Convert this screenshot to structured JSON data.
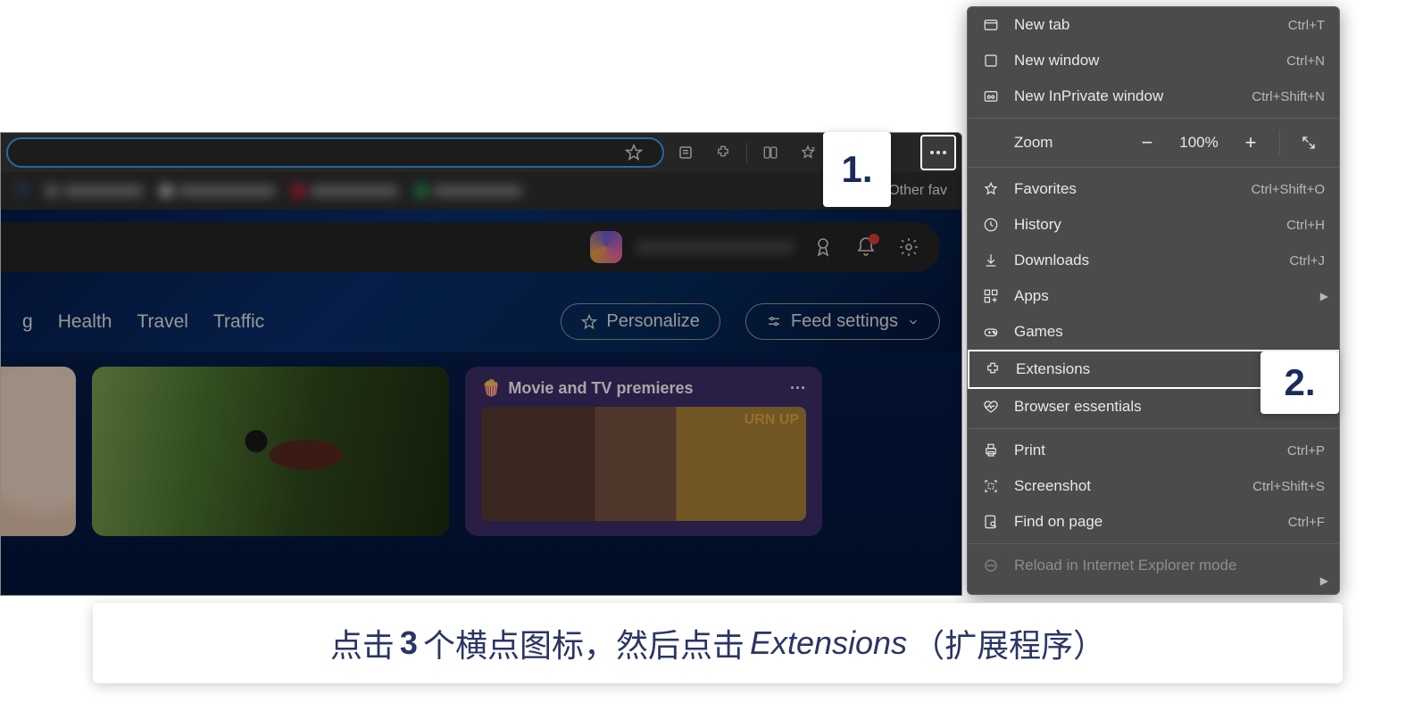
{
  "toolbar": {
    "other_favorites": "Other fav"
  },
  "nav_tabs": [
    "g",
    "Health",
    "Travel",
    "Traffic"
  ],
  "pills": {
    "personalize": "Personalize",
    "feed_settings": "Feed settings"
  },
  "card_movie": {
    "title": "Movie and TV premieres",
    "more": "···"
  },
  "zoom": {
    "label": "Zoom",
    "value": "100%"
  },
  "menu": {
    "new_tab": {
      "label": "New tab",
      "shortcut": "Ctrl+T"
    },
    "new_window": {
      "label": "New window",
      "shortcut": "Ctrl+N"
    },
    "new_inprivate": {
      "label": "New InPrivate window",
      "shortcut": "Ctrl+Shift+N"
    },
    "favorites": {
      "label": "Favorites",
      "shortcut": "Ctrl+Shift+O"
    },
    "history": {
      "label": "History",
      "shortcut": "Ctrl+H"
    },
    "downloads": {
      "label": "Downloads",
      "shortcut": "Ctrl+J"
    },
    "apps": {
      "label": "Apps"
    },
    "games": {
      "label": "Games"
    },
    "extensions": {
      "label": "Extensions"
    },
    "browser_essentials": {
      "label": "Browser essentials"
    },
    "print": {
      "label": "Print",
      "shortcut": "Ctrl+P"
    },
    "screenshot": {
      "label": "Screenshot",
      "shortcut": "Ctrl+Shift+S"
    },
    "find": {
      "label": "Find on page",
      "shortcut": "Ctrl+F"
    },
    "reload_ie": {
      "label": "Reload in Internet Explorer mode"
    }
  },
  "callouts": {
    "one": "1.",
    "two": "2."
  },
  "caption": {
    "p1": "点击 ",
    "bold": "3",
    "p2": " 个横点图标，然后点击 ",
    "italic": "Extensions",
    "p3": "（扩展程序）"
  }
}
